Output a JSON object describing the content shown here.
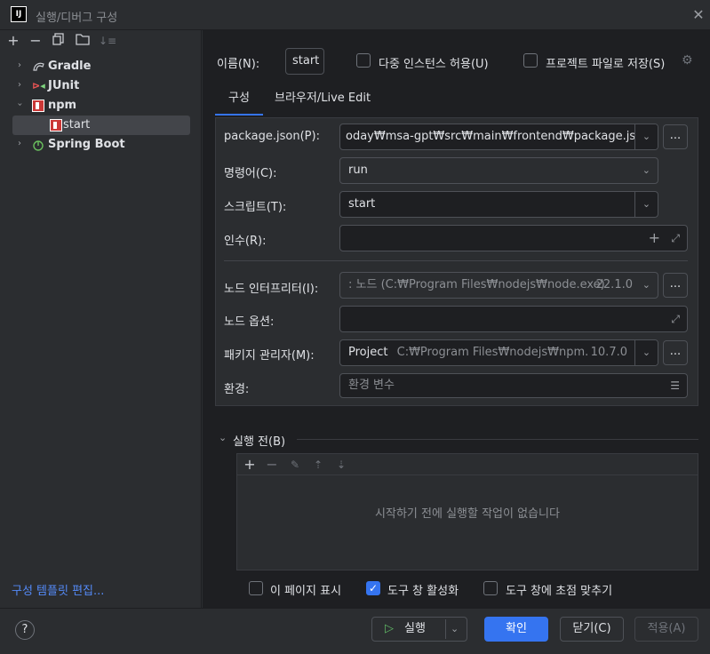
{
  "window": {
    "title": "실행/디버그 구성"
  },
  "sidebar": {
    "toolbar": [
      "plus-icon",
      "minus-icon",
      "copy-icon",
      "folder-icon",
      "sort-icon"
    ],
    "items": [
      {
        "label": "Gradle"
      },
      {
        "label": "JUnit"
      },
      {
        "label": "npm"
      },
      {
        "label": "start"
      },
      {
        "label": "Spring Boot"
      }
    ],
    "edit_templates": "구성 템플릿 편집..."
  },
  "header": {
    "name_label": "이름(N):",
    "name_value": "start",
    "multi_instance": "다중 인스턴스 허용(U)",
    "store_project": "프로젝트 파일로 저장(S)"
  },
  "tabs": [
    "구성",
    "브라우저/Live Edit"
  ],
  "form": {
    "package_json_label": "package.json(P):",
    "package_json_value": "oday₩msa-gpt₩src₩main₩frontend₩package.json",
    "command_label": "명령어(C):",
    "command_value": "run",
    "script_label": "스크립트(T):",
    "script_value": "start",
    "args_label": "인수(R):",
    "node_interp_label": "노드 인터프리터(I):",
    "node_interp_prefix": "노드",
    "node_interp_path": "(C:₩Program Files₩nodejs₩node.exe)",
    "node_interp_version": "22.1.0",
    "node_options_label": "노드 옵션:",
    "pkg_manager_label": "패키지 관리자(M):",
    "pkg_manager_name": "Project",
    "pkg_manager_path": "C:₩Program Files₩nodejs₩npm.cr",
    "pkg_manager_version": "10.7.0",
    "env_label": "환경:",
    "env_placeholder": "환경 변수",
    "dots": "..."
  },
  "before_launch": {
    "title": "실행 전(B)",
    "empty": "시작하기 전에 실행할 작업이 없습니다"
  },
  "options": {
    "show_page": "이 페이지 표시",
    "activate_tool": "도구 창 활성화",
    "focus_tool": "도구 창에 초점 맞추기"
  },
  "buttons": {
    "help": "?",
    "run": "실행",
    "ok": "확인",
    "close": "닫기(C)",
    "apply": "적용(A)"
  }
}
